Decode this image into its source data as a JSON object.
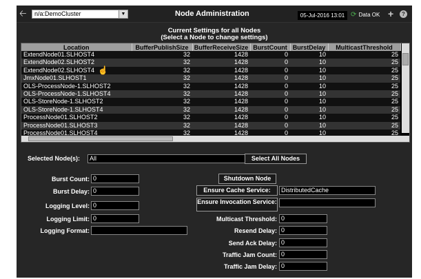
{
  "header": {
    "cluster_value": "n/a:DemoCluster",
    "title": "Node Administration",
    "datetime": "05-Jul-2016 13:01",
    "status_text": "Data OK"
  },
  "table": {
    "title_line1": "Current Settings for all Nodes",
    "title_line2": "(Select a Node to change settings)",
    "columns": [
      "Location",
      "BufferPublishSize",
      "BufferReceiveSize",
      "BurstCount",
      "BurstDelay",
      "MulticastThreshold"
    ],
    "rows": [
      [
        "ExtendNode01.SLHOST4",
        "32",
        "1428",
        "0",
        "10",
        "25"
      ],
      [
        "ExtendNode02.SLHOST2",
        "32",
        "1428",
        "0",
        "10",
        "25"
      ],
      [
        "ExtendNode02.SLHOST4",
        "32",
        "1428",
        "0",
        "10",
        "25"
      ],
      [
        "JmxNode01.SLHOST1",
        "32",
        "1428",
        "0",
        "10",
        "25"
      ],
      [
        "OLS-ProcessNode-1.SLHOST2",
        "32",
        "1428",
        "0",
        "10",
        "25"
      ],
      [
        "OLS-ProcessNode-1.SLHOST4",
        "32",
        "1428",
        "0",
        "10",
        "25"
      ],
      [
        "OLS-StoreNode-1.SLHOST2",
        "32",
        "1428",
        "0",
        "10",
        "25"
      ],
      [
        "OLS-StoreNode-1.SLHOST4",
        "32",
        "1428",
        "0",
        "10",
        "25"
      ],
      [
        "ProcessNode01.SLHOST2",
        "32",
        "1428",
        "0",
        "10",
        "25"
      ],
      [
        "ProcessNode01.SLHOST3",
        "32",
        "1428",
        "0",
        "10",
        "25"
      ],
      [
        "ProcessNode01.SLHOST4",
        "32",
        "1428",
        "0",
        "10",
        "25"
      ]
    ]
  },
  "selection": {
    "label": "Selected Node(s):",
    "value": "All",
    "select_all_label": "Select All Nodes"
  },
  "form": {
    "burst_count_label": "Burst Count:",
    "burst_count_value": "0",
    "burst_delay_label": "Burst Delay:",
    "burst_delay_value": "0",
    "logging_level_label": "Logging Level:",
    "logging_level_value": "0",
    "logging_limit_label": "Logging Limit:",
    "logging_limit_value": "0",
    "logging_format_label": "Logging Format:",
    "logging_format_value": "",
    "shutdown_label": "Shutdown Node",
    "ensure_cache_label": "Ensure Cache Service:",
    "ensure_cache_value": "DistributedCache",
    "ensure_invocation_label": "Ensure Invocation Service:",
    "ensure_invocation_value": "",
    "multicast_threshold_label": "Multicast Threshold:",
    "multicast_threshold_value": "0",
    "resend_delay_label": "Resend Delay:",
    "resend_delay_value": "0",
    "send_ack_delay_label": "Send Ack Delay:",
    "send_ack_delay_value": "0",
    "traffic_jam_count_label": "Traffic Jam Count:",
    "traffic_jam_count_value": "0",
    "traffic_jam_delay_label": "Traffic Jam Delay:",
    "traffic_jam_delay_value": "0"
  },
  "icons": {
    "back": "back-arrow-icon",
    "status_ok": "refresh-check-icon",
    "add": "plus-icon",
    "help": "help-icon"
  },
  "colors": {
    "background": "#262626",
    "header_col": "#9e9e9e",
    "status_ok": "#4caf50"
  }
}
